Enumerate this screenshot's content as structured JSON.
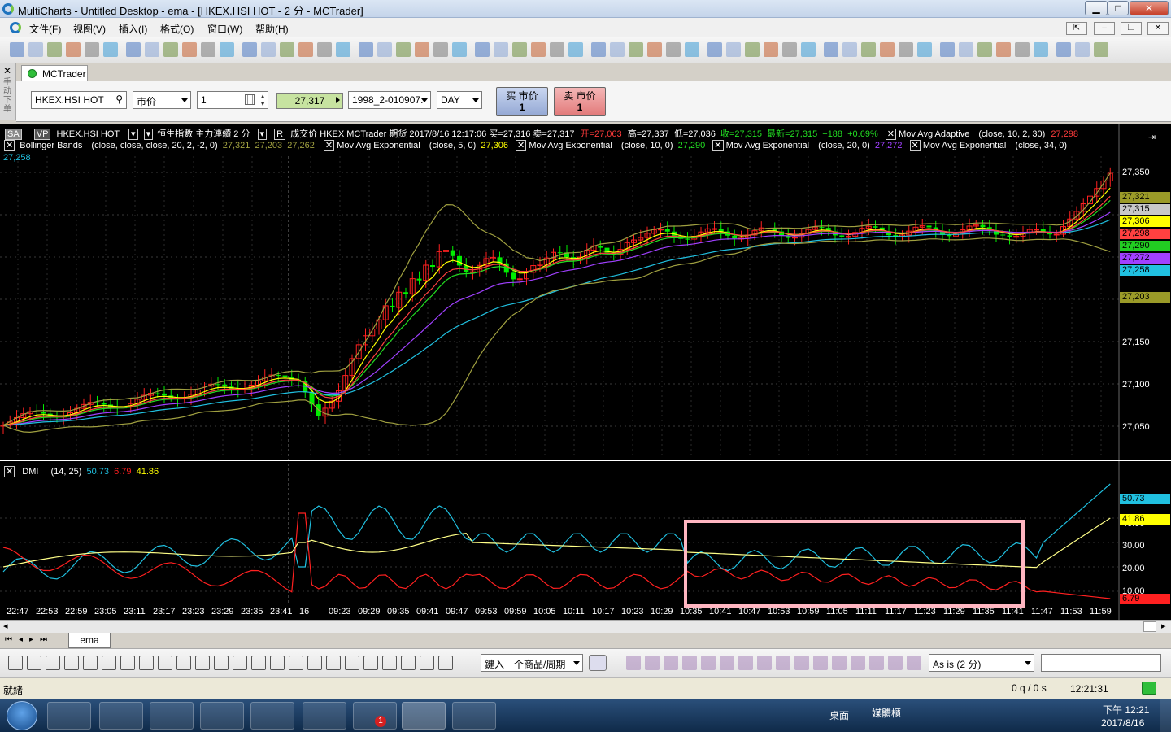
{
  "window": {
    "title": "MultiCharts - Untitled Desktop - ema - [HKEX.HSI HOT - 2 分 - MCTrader]",
    "min": "▁",
    "max": "□",
    "close": "✕"
  },
  "menu": [
    "文件(F)",
    "视图(V)",
    "插入(I)",
    "格式(O)",
    "窗口(W)",
    "帮助(H)"
  ],
  "mdi": [
    "⇱",
    "–",
    "❐",
    "✕"
  ],
  "left_strip": "手动下单",
  "tab": {
    "label": "MCTrader"
  },
  "order": {
    "symbol": "HKEX.HSI HOT",
    "order_type": "市价",
    "quantity": "1",
    "price": "27,317",
    "account": "1998_2-010907.",
    "tif": "DAY",
    "buy_label": "买 市价",
    "buy_qty": "1",
    "sell_label": "卖 市价",
    "sell_qty": "1"
  },
  "chart_header": {
    "sa": "SA",
    "vp": "VP",
    "symbol": "HKEX.HSI HOT",
    "desc": "恒生指數 主力連續  2 分",
    "r": "R",
    "text": "成交价  HKEX  MCTrader  期货  2017/8/16  12:17:06  买=27,316  卖=27,317",
    "open": "开=27,063",
    "high": "高=27,337",
    "low": "低=27,036",
    "close": "收=27,315",
    "last": "最新=27,315",
    "chg": "+188",
    "pct": "+0.69%",
    "ama_name": "Mov Avg Adaptive",
    "ama_params": "(close,  10,  2,  30)",
    "ama_val": "27,298"
  },
  "indicators_line2": {
    "bb_name": "Bollinger Bands",
    "bb_params": "(close,  close,  close,  20,  2,  -2,  0)",
    "bb_v1": "27,321",
    "bb_v2": "27,203",
    "bb_v3": "27,262",
    "e5_name": "Mov Avg Exponential",
    "e5_params": "(close,  5,  0)",
    "e5_val": "27,306",
    "e10_name": "Mov Avg Exponential",
    "e10_params": "(close,  10,  0)",
    "e10_val": "27,290",
    "e20_name": "Mov Avg Exponential",
    "e20_params": "(close,  20,  0)",
    "e20_val": "27,272",
    "e34_name": "Mov Avg Exponential",
    "e34_params": "(close,  34,  0)",
    "e34_val": "27,258"
  },
  "price_axis": [
    "27,350",
    "27,150",
    "27,100",
    "27,050"
  ],
  "price_boxes": [
    {
      "text": "27,321",
      "color": "#9a9a28"
    },
    {
      "text": "27,315",
      "color": "#c8c8c8"
    },
    {
      "text": "27,306",
      "color": "#ffff00"
    },
    {
      "text": "27,298",
      "color": "#ff4040"
    },
    {
      "text": "27,290",
      "color": "#22cc22"
    },
    {
      "text": "27,272",
      "color": "#a040ff"
    },
    {
      "text": "27,258",
      "color": "#20c0e0"
    },
    {
      "text": "27,203",
      "color": "#9a9a28"
    }
  ],
  "dmi": {
    "name": "DMI",
    "params": "(14,  25)",
    "v1": "50.73",
    "v2": "6.79",
    "v3": "41.86"
  },
  "dmi_axis": [
    "40.00",
    "30.00",
    "20.00",
    "10.00"
  ],
  "dmi_boxes": [
    {
      "text": "50.73",
      "color": "#20c0e0"
    },
    {
      "text": "41.86",
      "color": "#ffff00"
    },
    {
      "text": "6.79",
      "color": "#ff2020"
    }
  ],
  "time_axis": [
    "22:47",
    "22:53",
    "22:59",
    "23:05",
    "23:11",
    "23:17",
    "23:23",
    "23:29",
    "23:35",
    "23:41",
    "16",
    "09:23",
    "09:29",
    "09:35",
    "09:41",
    "09:47",
    "09:53",
    "09:59",
    "10:05",
    "10:11",
    "10:17",
    "10:23",
    "10:29",
    "10:35",
    "10:41",
    "10:47",
    "10:53",
    "10:59",
    "11:05",
    "11:11",
    "11:17",
    "11:23",
    "11:29",
    "11:35",
    "11:41",
    "11:47",
    "11:53",
    "11:59"
  ],
  "sheet_tab": "ema",
  "toolbar2": {
    "symbol_period_placeholder": "鍵入一个商品/周期",
    "as_is": "As is (2 分)"
  },
  "status": {
    "ready": "就緒",
    "orders": "0 q / 0 s",
    "time": "12:21:31"
  },
  "taskbar": {
    "desktop": "桌面",
    "media": "媒體櫃",
    "time": "下午 12:21",
    "date": "2017/8/16",
    "notif": "1"
  },
  "colors": {
    "bg": "#000000",
    "bull": "#00ee00",
    "bear": "#ff2020",
    "highlight": "#ffb6c1"
  }
}
